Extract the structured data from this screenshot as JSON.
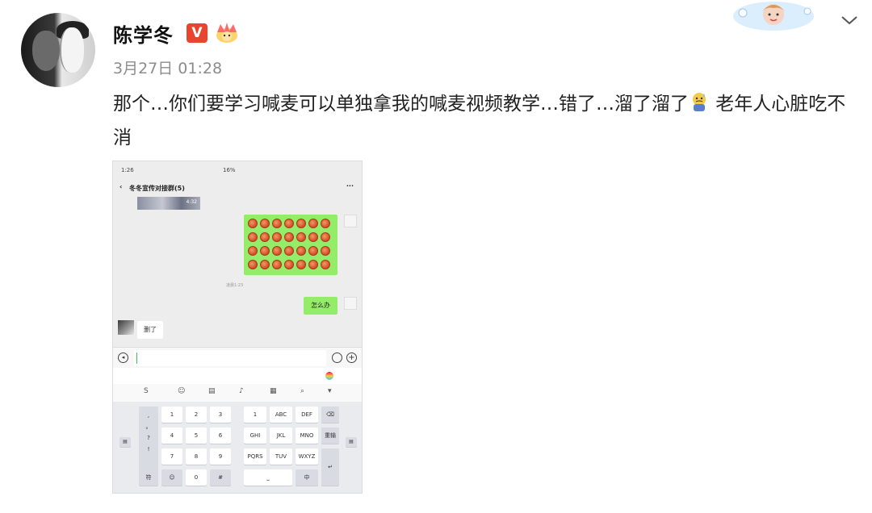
{
  "post": {
    "username": "陈学冬",
    "v_badge": "V",
    "timestamp": "3月27日 01:28",
    "text_part1": "那个…你们要学习喊麦可以单独拿我的喊麦视频教学…错了…溜了溜了",
    "text_part2": " 老年人心脏吃不消"
  },
  "phone": {
    "status_time": "1:26",
    "status_right": "16%",
    "back_glyph": "‹",
    "chat_title": "冬冬宣传对接群(5)",
    "more_glyph": "···",
    "video_duration": "4:32",
    "mid_timestamp": "凌晨1:23",
    "my_message": "怎么办",
    "their_message": "删了",
    "keyboard": {
      "row1": [
        "1",
        "2",
        "3",
        "1",
        "ABC",
        "DEF"
      ],
      "row2": [
        "4",
        "5",
        "6",
        "GHI",
        "JKL",
        "MNO",
        "重输"
      ],
      "row3": [
        "7",
        "8",
        "9",
        "PQRS",
        "TUV",
        "WXYZ"
      ],
      "row4": [
        "符",
        "0",
        "#",
        "中"
      ],
      "side": [
        ",",
        "。",
        "?",
        "!"
      ]
    }
  },
  "colors": {
    "bubble_green": "#95ec69",
    "v_badge": "#e8442e",
    "timestamp": "#8c8c8c"
  }
}
